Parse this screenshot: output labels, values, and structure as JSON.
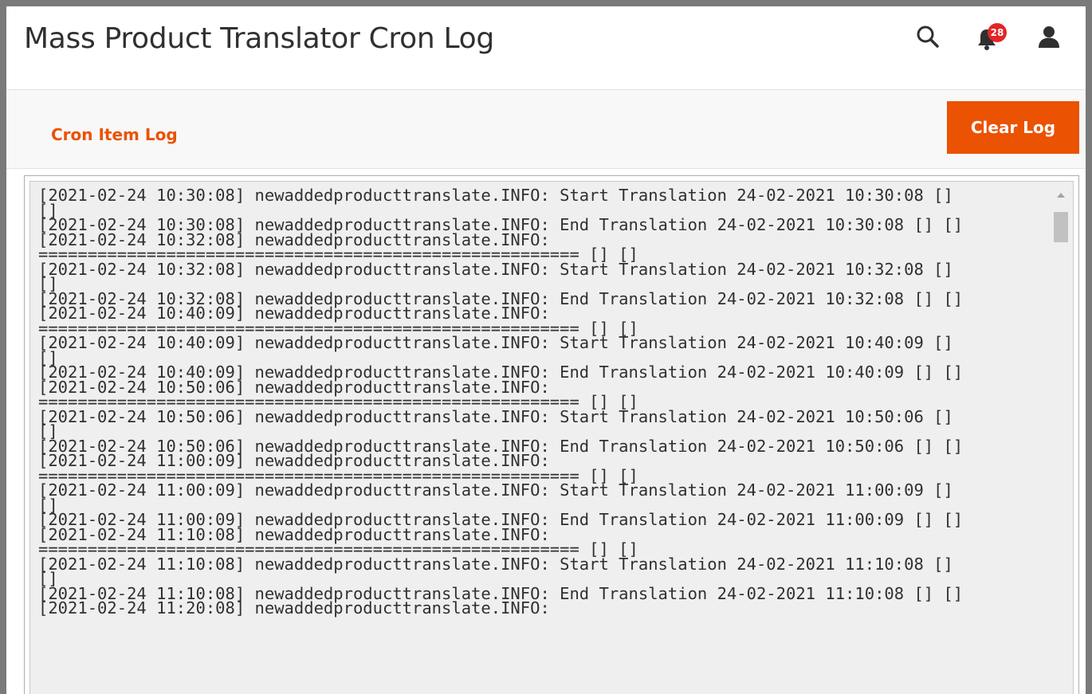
{
  "page": {
    "title": "Mass Product Translator Cron Log"
  },
  "header": {
    "notifications_count": "28",
    "icons": [
      "search-icon",
      "bell-icon",
      "user-icon"
    ]
  },
  "toolbar": {
    "section_title": "Cron Item Log",
    "clear_log_label": "Clear Log"
  },
  "colors": {
    "accent": "#eb5202",
    "badge": "#e22626",
    "title_text": "#303030",
    "log_background": "#efefef",
    "toolbar_background": "#f8f8f8"
  },
  "log": {
    "lines": [
      "[2021-02-24 10:30:08] newaddedproducttranslate.INFO: Start Translation 24-02-2021 10:30:08 []",
      "[]",
      "[2021-02-24 10:30:08] newaddedproducttranslate.INFO: End Translation 24-02-2021 10:30:08 [] []",
      "[2021-02-24 10:32:08] newaddedproducttranslate.INFO:",
      "======================================================= [] []",
      "[2021-02-24 10:32:08] newaddedproducttranslate.INFO: Start Translation 24-02-2021 10:32:08 []",
      "[]",
      "[2021-02-24 10:32:08] newaddedproducttranslate.INFO: End Translation 24-02-2021 10:32:08 [] []",
      "[2021-02-24 10:40:09] newaddedproducttranslate.INFO:",
      "======================================================= [] []",
      "[2021-02-24 10:40:09] newaddedproducttranslate.INFO: Start Translation 24-02-2021 10:40:09 []",
      "[]",
      "[2021-02-24 10:40:09] newaddedproducttranslate.INFO: End Translation 24-02-2021 10:40:09 [] []",
      "[2021-02-24 10:50:06] newaddedproducttranslate.INFO:",
      "======================================================= [] []",
      "[2021-02-24 10:50:06] newaddedproducttranslate.INFO: Start Translation 24-02-2021 10:50:06 []",
      "[]",
      "[2021-02-24 10:50:06] newaddedproducttranslate.INFO: End Translation 24-02-2021 10:50:06 [] []",
      "[2021-02-24 11:00:09] newaddedproducttranslate.INFO:",
      "======================================================= [] []",
      "[2021-02-24 11:00:09] newaddedproducttranslate.INFO: Start Translation 24-02-2021 11:00:09 []",
      "[]",
      "[2021-02-24 11:00:09] newaddedproducttranslate.INFO: End Translation 24-02-2021 11:00:09 [] []",
      "[2021-02-24 11:10:08] newaddedproducttranslate.INFO:",
      "======================================================= [] []",
      "[2021-02-24 11:10:08] newaddedproducttranslate.INFO: Start Translation 24-02-2021 11:10:08 []",
      "[]",
      "[2021-02-24 11:10:08] newaddedproducttranslate.INFO: End Translation 24-02-2021 11:10:08 [] []",
      "[2021-02-24 11:20:08] newaddedproducttranslate.INFO:"
    ]
  }
}
